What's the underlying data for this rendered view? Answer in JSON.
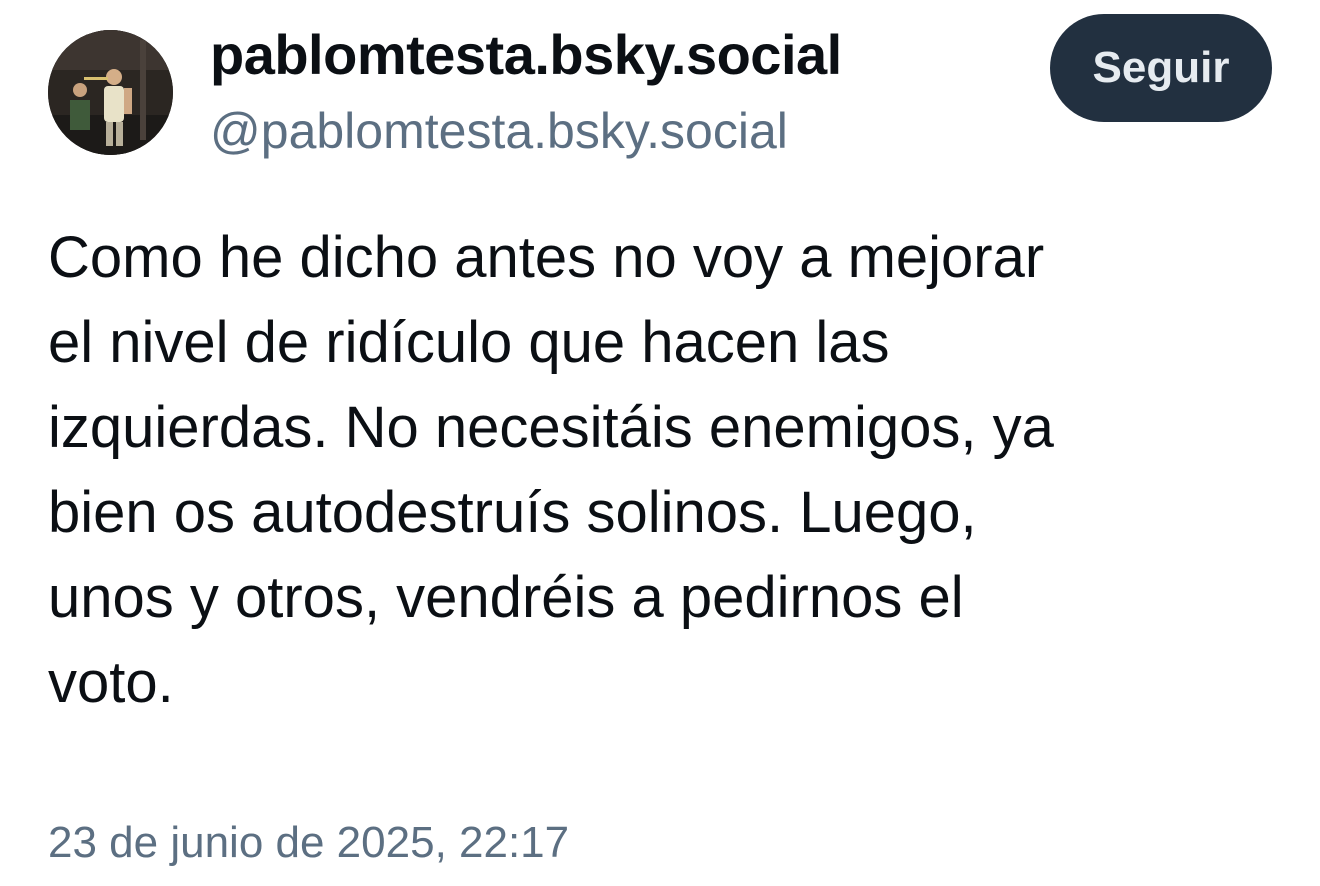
{
  "author": {
    "display_name": "pablomtesta.bsky.social",
    "handle": "@pablomtesta.bsky.social",
    "avatar_icon": "avatar-photo-musicians-on-stage"
  },
  "follow_button": {
    "label": "Seguir"
  },
  "post": {
    "lines": [
      "Como he dicho antes no voy a mejorar",
      "el nivel de ridículo que hacen las",
      "izquierdas. No necesitáis enemigos, ya",
      "bien os autodestruís solinos. Luego,",
      "unos y otros, vendréis a pedirnos el",
      "voto."
    ],
    "timestamp": "23 de junio de 2025, 22:17"
  },
  "colors": {
    "text_primary": "#0b0f14",
    "text_secondary": "#5c6f82",
    "button_background": "#223040",
    "button_text": "#e6ebf0",
    "page_background": "#ffffff"
  }
}
